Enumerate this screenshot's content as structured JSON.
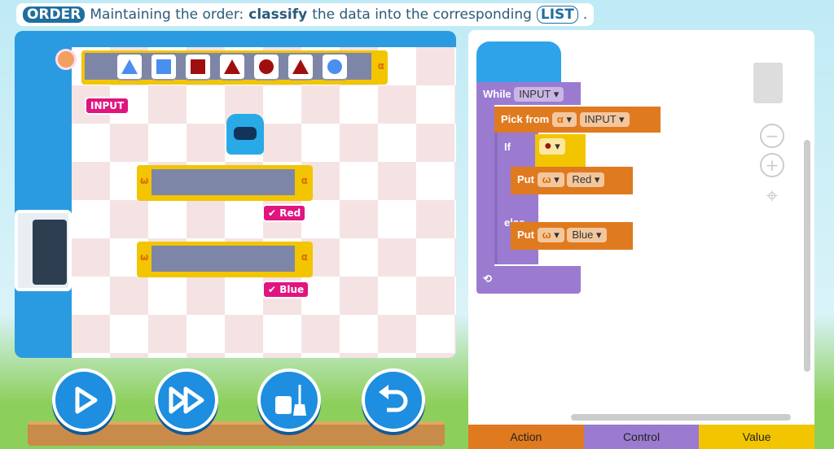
{
  "banner": {
    "tag": "ORDER",
    "text1": "Maintaining the order:",
    "bold": "classify",
    "text2": "the data into the corresponding",
    "pill": "LIST",
    "end": "."
  },
  "game": {
    "input_label": "INPUT",
    "conveyor_symbol": "α",
    "items": [
      {
        "shape": "triangle",
        "color": "#4a8ef0"
      },
      {
        "shape": "square",
        "color": "#4a8ef0"
      },
      {
        "shape": "square",
        "color": "#a00f0f"
      },
      {
        "shape": "triangle",
        "color": "#a00f0f"
      },
      {
        "shape": "circle",
        "color": "#a00f0f"
      },
      {
        "shape": "triangle",
        "color": "#a00f0f"
      },
      {
        "shape": "circle",
        "color": "#4a8ef0"
      }
    ],
    "lists": [
      {
        "left": "ω",
        "right": "α",
        "label": "Red"
      },
      {
        "left": "ω",
        "right": "α",
        "label": "Blue"
      }
    ],
    "check": "✔"
  },
  "controls": {
    "play": "play-icon",
    "fast_forward": "fast-forward-icon",
    "clear": "broom-icon",
    "undo": "undo-icon"
  },
  "code": {
    "while": "While",
    "while_arg": "INPUT",
    "pick": "Pick from",
    "pick_list": "α",
    "pick_arg": "INPUT",
    "if": "If",
    "put1": "Put",
    "put1_list": "ω",
    "put1_arg": "Red",
    "else": "else",
    "put2": "Put",
    "put2_list": "ω",
    "put2_arg": "Blue",
    "loop": "⟲",
    "caret": "▾"
  },
  "workspace": {
    "zoom_out": "−",
    "zoom_in": "+",
    "center": "⌖"
  },
  "tabs": [
    {
      "label": "Action",
      "color": "#e07a1f"
    },
    {
      "label": "Control",
      "color": "#9b7bd0"
    },
    {
      "label": "Value",
      "color": "#f2c500"
    }
  ]
}
